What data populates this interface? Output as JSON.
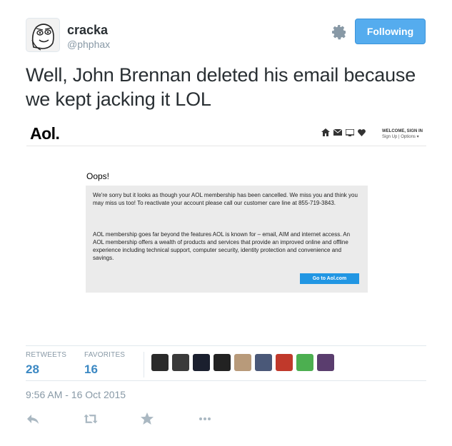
{
  "user": {
    "name": "cracka",
    "handle": "@phphax"
  },
  "follow_button": {
    "label": "Following"
  },
  "tweet": {
    "text": "Well, John Brennan deleted his email because we kept jacking it LOL"
  },
  "embedded": {
    "logo": "Aol.",
    "header": {
      "welcome": "WELCOME, SIGN IN",
      "links": "Sign Up | Options ▾"
    },
    "title": "Oops!",
    "paragraph1": "We're sorry but it looks as though your AOL membership has been cancelled. We miss you and think you may miss us too! To reactivate your account please call our customer care line at 855-719-3843.",
    "paragraph2": "AOL membership goes far beyond the features AOL is known for – email, AIM and internet access. An AOL membership offers a wealth of products and services that provide an improved online and offline experience including technical support, computer security, identity protection and convenience and savings.",
    "button": "Go to Aol.com",
    "icons": [
      "home-icon",
      "mail-icon",
      "tv-icon",
      "heart-icon"
    ]
  },
  "stats": {
    "retweets_label": "RETWEETS",
    "retweets": "28",
    "favorites_label": "FAVORITES",
    "favorites": "16"
  },
  "timestamp": "9:56 AM - 16 Oct 2015",
  "favoriters": [
    "#2a2a2a",
    "#3a3a3a",
    "#1a1f2e",
    "#222222",
    "#b89a7a",
    "#4a5878",
    "#c0392b",
    "#4caf50",
    "#5a3d6e"
  ],
  "colors": {
    "accent": "#55acee",
    "link": "#3b88c3",
    "muted": "#8899a6"
  }
}
